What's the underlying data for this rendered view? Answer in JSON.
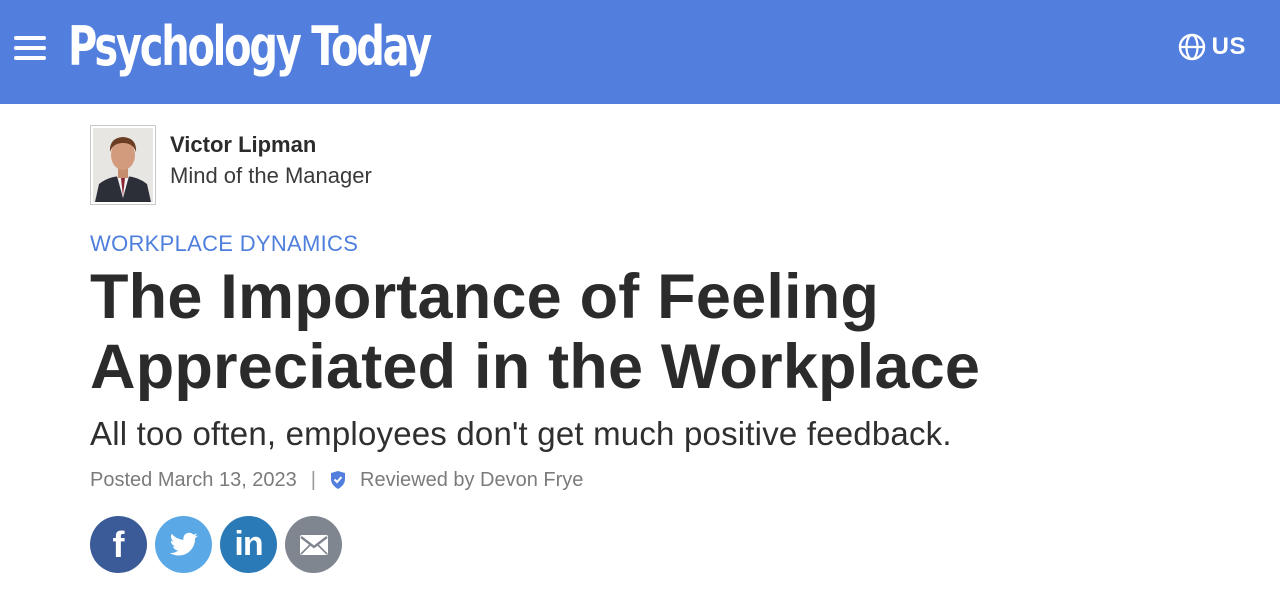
{
  "header": {
    "logo_text": "Psychology Today",
    "region_label": "US",
    "menu_icon": "hamburger-icon",
    "region_icon": "globe-icon",
    "background_color": "#527edd"
  },
  "author": {
    "name": "Victor Lipman",
    "column": "Mind of the Manager"
  },
  "article": {
    "category": "WORKPLACE DYNAMICS",
    "title": "The Importance of Feeling Appreciated in the Workplace",
    "subtitle": "All too often, employees don't get much positive feedback.",
    "posted": "Posted March 13, 2023",
    "separator": "|",
    "reviewed": "Reviewed by Devon Frye"
  },
  "share": {
    "buttons": [
      {
        "name": "facebook",
        "icon": "facebook-icon",
        "glyph": "f",
        "color": "#3a5a98"
      },
      {
        "name": "twitter",
        "icon": "twitter-icon",
        "glyph": "",
        "color": "#5aa9e6"
      },
      {
        "name": "linkedin",
        "icon": "linkedin-icon",
        "glyph": "in",
        "color": "#2a7ab8"
      },
      {
        "name": "email",
        "icon": "email-icon",
        "glyph": "",
        "color": "#7f8690"
      }
    ]
  }
}
